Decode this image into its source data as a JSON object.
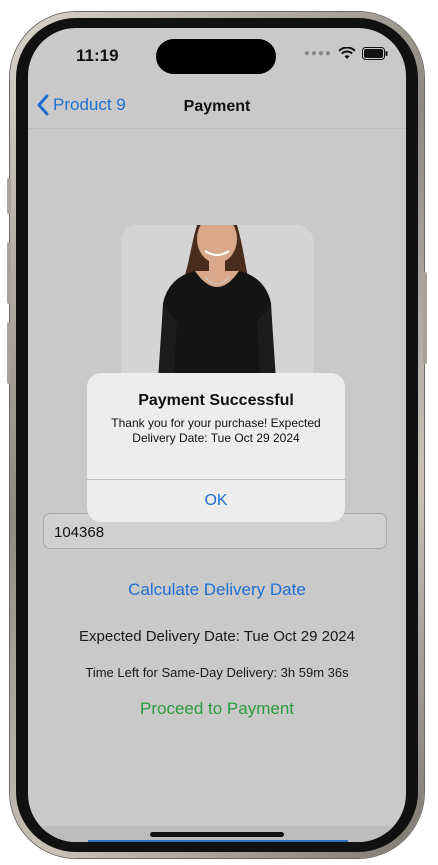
{
  "status_bar": {
    "time": "11:19"
  },
  "nav": {
    "back_label": "Product 9",
    "title": "Payment"
  },
  "form": {
    "zip_value": "104368"
  },
  "actions": {
    "calculate_label": "Calculate Delivery Date",
    "expected_delivery": "Expected Delivery Date: Tue Oct 29 2024",
    "time_left": "Time Left for Same-Day Delivery: 3h 59m 36s",
    "proceed_label": "Proceed to Payment"
  },
  "alert": {
    "title": "Payment Successful",
    "message": "Thank you for your purchase! Expected Delivery Date: Tue Oct 29 2024",
    "ok_label": "OK"
  },
  "colors": {
    "accent_blue": "#1f6fd1",
    "proceed_green": "#2c9a3e",
    "screen_bg": "#c9c9c9"
  }
}
